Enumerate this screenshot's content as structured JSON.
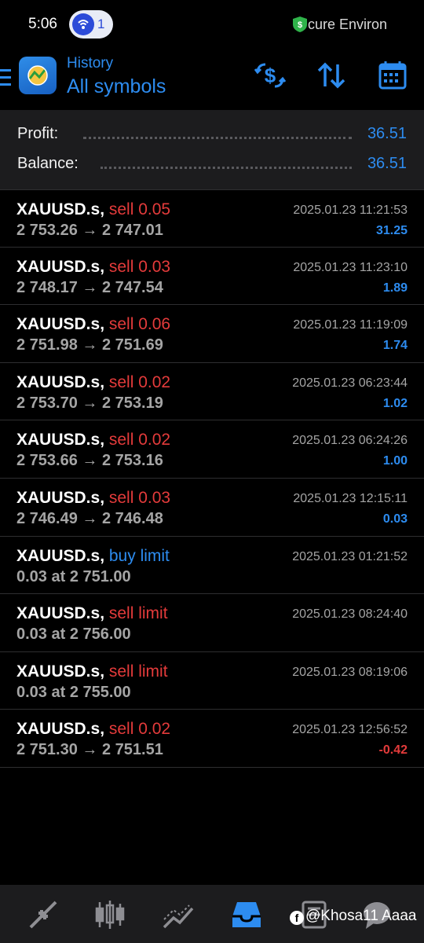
{
  "status_bar": {
    "time": "5:06",
    "notification_count": "1",
    "secure_text": "cure Environ"
  },
  "header": {
    "subtitle": "History",
    "title": "All symbols"
  },
  "summary": {
    "profit_label": "Profit:",
    "profit_value": "36.51",
    "balance_label": "Balance:",
    "balance_value": "36.51"
  },
  "rows": [
    {
      "symbol": "XAUUSD.s,",
      "type": "sell 0.05",
      "detail": "2 753.26 → 2 747.01",
      "time": "2025.01.23 11:21:53",
      "profit": "31.25"
    },
    {
      "symbol": "XAUUSD.s,",
      "type": "sell 0.03",
      "detail": "2 748.17 → 2 747.54",
      "time": "2025.01.23 11:23:10",
      "profit": "1.89"
    },
    {
      "symbol": "XAUUSD.s,",
      "type": "sell 0.06",
      "detail": "2 751.98 → 2 751.69",
      "time": "2025.01.23 11:19:09",
      "profit": "1.74"
    },
    {
      "symbol": "XAUUSD.s,",
      "type": "sell 0.02",
      "detail": "2 753.70 → 2 753.19",
      "time": "2025.01.23 06:23:44",
      "profit": "1.02"
    },
    {
      "symbol": "XAUUSD.s,",
      "type": "sell 0.02",
      "detail": "2 753.66 → 2 753.16",
      "time": "2025.01.23 06:24:26",
      "profit": "1.00"
    },
    {
      "symbol": "XAUUSD.s,",
      "type": "sell 0.03",
      "detail": "2 746.49 → 2 746.48",
      "time": "2025.01.23 12:15:11",
      "profit": "0.03"
    },
    {
      "symbol": "XAUUSD.s,",
      "type": "buy limit",
      "detail": "0.03 at 2 751.00",
      "time": "2025.01.23 01:21:52",
      "profit": ""
    },
    {
      "symbol": "XAUUSD.s,",
      "type": "sell limit",
      "detail": "0.03 at 2 756.00",
      "time": "2025.01.23 08:24:40",
      "profit": ""
    },
    {
      "symbol": "XAUUSD.s,",
      "type": "sell limit",
      "detail": "0.03 at 2 755.00",
      "time": "2025.01.23 08:19:06",
      "profit": ""
    },
    {
      "symbol": "XAUUSD.s,",
      "type": "sell 0.02",
      "detail": "2 751.30 → 2 751.51",
      "time": "2025.01.23 12:56:52",
      "profit": "-0.42"
    }
  ],
  "colors": {
    "accent": "#2d8cf0",
    "sell": "#e43b3b",
    "buy": "#2d8cf0",
    "background": "#000000",
    "panel": "#1c1c1e"
  },
  "icons": {
    "header": [
      "deposit-exchange-icon",
      "sort-icon",
      "calendar-icon"
    ],
    "bottom_nav": [
      "quotes-icon",
      "chart-icon",
      "trade-icon",
      "history-icon",
      "news-icon",
      "chat-icon"
    ]
  },
  "watermark": "@Khosa11 Aaaa"
}
